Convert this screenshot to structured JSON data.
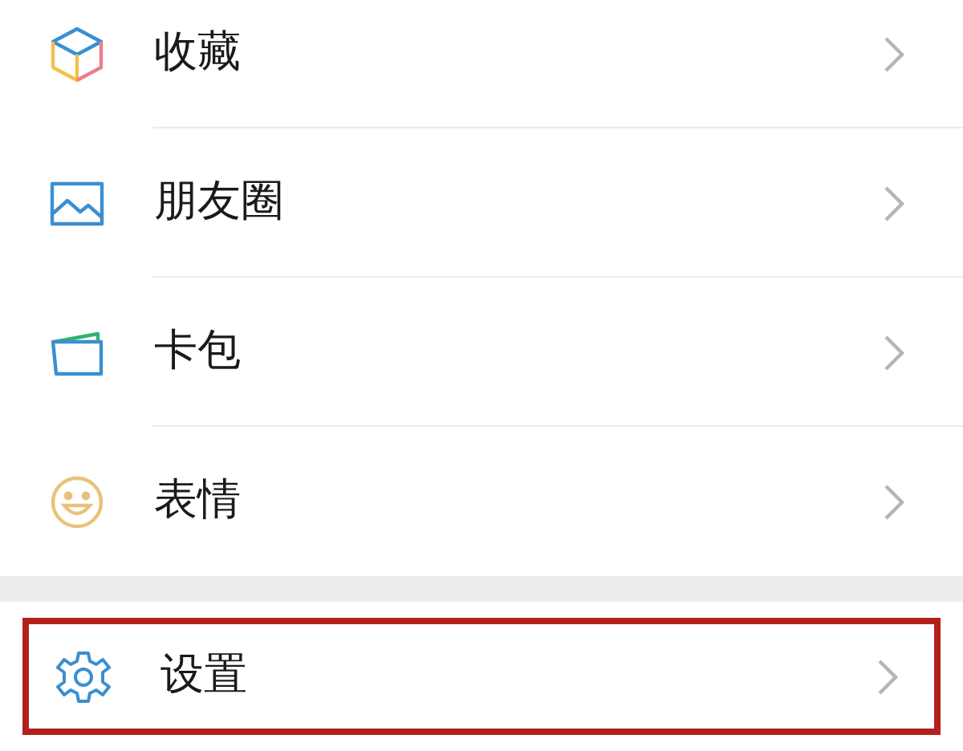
{
  "groups": [
    {
      "items": [
        {
          "kind": "cube",
          "label": "收藏",
          "highlighted": false
        },
        {
          "kind": "picture",
          "label": "朋友圈",
          "highlighted": false
        },
        {
          "kind": "wallet",
          "label": "卡包",
          "highlighted": false
        },
        {
          "kind": "smile",
          "label": "表情",
          "highlighted": false
        }
      ]
    },
    {
      "items": [
        {
          "kind": "gear",
          "label": "设置",
          "highlighted": true
        }
      ]
    }
  ]
}
